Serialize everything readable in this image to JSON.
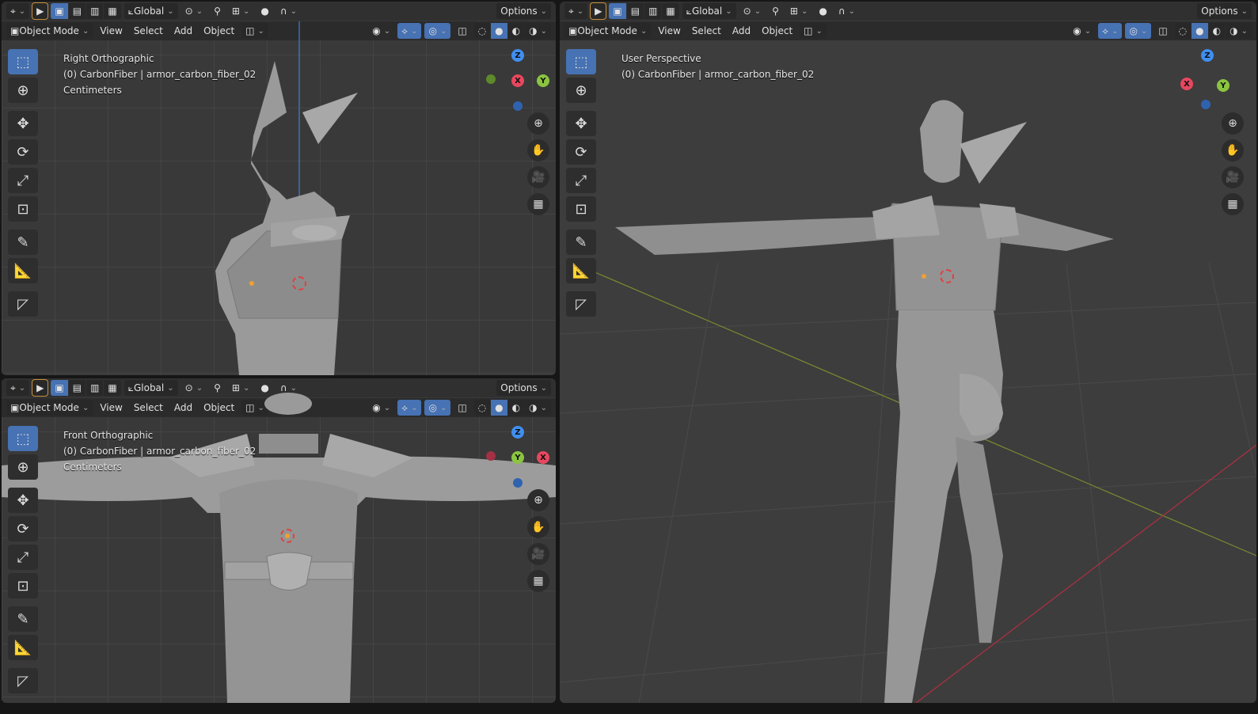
{
  "header": {
    "global_label": "Global",
    "options_label": "Options",
    "mode_label": "Object Mode",
    "menus": [
      "View",
      "Select",
      "Add",
      "Object"
    ]
  },
  "viewports": {
    "right_ortho": {
      "view_name": "Right Orthographic",
      "collection": "(0) CarbonFiber | armor_carbon_fiber_02",
      "units": "Centimeters",
      "gizmo": {
        "z": "Z",
        "x": "X",
        "y": "Y"
      }
    },
    "front_ortho": {
      "view_name": "Front Orthographic",
      "collection": "(0) CarbonFiber | armor_carbon_fiber_02",
      "units": "Centimeters",
      "gizmo": {
        "z": "Z",
        "x": "X",
        "y": "Y"
      }
    },
    "user_persp": {
      "view_name": "User Perspective",
      "collection": "(0) CarbonFiber | armor_carbon_fiber_02",
      "gizmo": {
        "z": "Z",
        "x": "X",
        "y": "Y"
      }
    }
  },
  "colors": {
    "axis_x": "#e8475f",
    "axis_y": "#8bc540",
    "axis_z": "#3f8ff0",
    "selection": "#4772b3",
    "origin": "#f0a030"
  },
  "icons": {
    "tools": [
      "select-box-icon",
      "cursor-icon",
      "move-icon",
      "rotate-icon",
      "scale-icon",
      "transform-icon",
      "annotate-icon",
      "measure-icon",
      "add-cube-icon"
    ],
    "nav": [
      "zoom-icon",
      "pan-hand-icon",
      "camera-icon",
      "grid-icon"
    ]
  }
}
